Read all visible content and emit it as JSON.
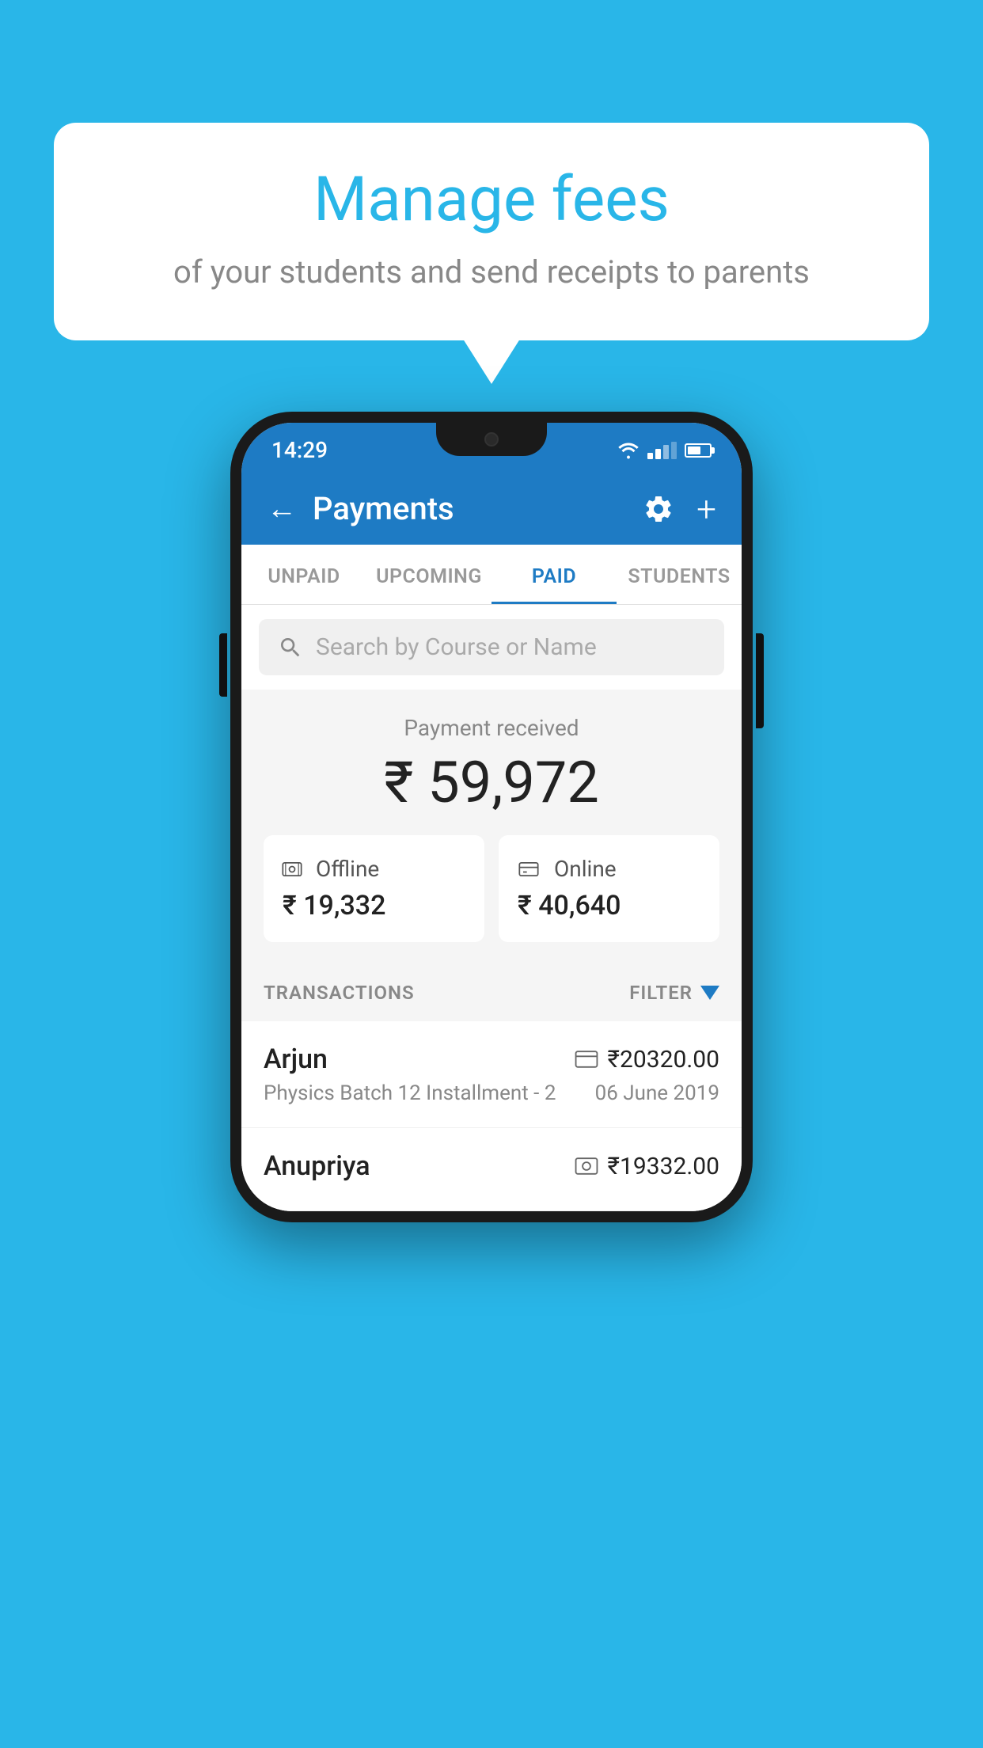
{
  "background_color": "#29b6e8",
  "bubble": {
    "title": "Manage fees",
    "subtitle": "of your students and send receipts to parents"
  },
  "status_bar": {
    "time": "14:29"
  },
  "app_bar": {
    "title": "Payments",
    "back_label": "←",
    "plus_label": "+"
  },
  "tabs": [
    {
      "label": "UNPAID",
      "active": false
    },
    {
      "label": "UPCOMING",
      "active": false
    },
    {
      "label": "PAID",
      "active": true
    },
    {
      "label": "STUDENTS",
      "active": false
    }
  ],
  "search": {
    "placeholder": "Search by Course or Name"
  },
  "payment": {
    "label": "Payment received",
    "amount": "₹ 59,972",
    "offline": {
      "type": "Offline",
      "amount": "₹ 19,332"
    },
    "online": {
      "type": "Online",
      "amount": "₹ 40,640"
    }
  },
  "transactions": {
    "header": "TRANSACTIONS",
    "filter": "FILTER",
    "rows": [
      {
        "name": "Arjun",
        "description": "Physics Batch 12 Installment - 2",
        "amount": "₹20320.00",
        "date": "06 June 2019",
        "icon_type": "card"
      },
      {
        "name": "Anupriya",
        "description": "",
        "amount": "₹19332.00",
        "date": "",
        "icon_type": "cash"
      }
    ]
  }
}
